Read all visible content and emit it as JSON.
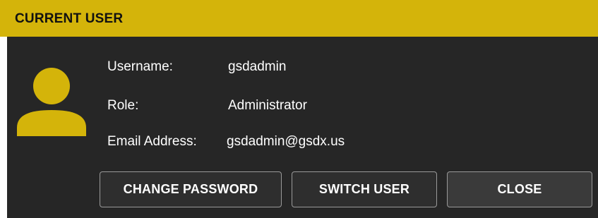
{
  "dialog": {
    "title": "CURRENT USER",
    "accent_color": "#d4b40a",
    "panel_color": "#262626"
  },
  "user": {
    "avatar_icon": "user-icon",
    "fields": [
      {
        "label": "Username:",
        "value": "gsdadmin"
      },
      {
        "label": "Role:",
        "value": "Administrator"
      },
      {
        "label": "Email Address:",
        "value": "gsdadmin@gsdx.us"
      }
    ]
  },
  "buttons": {
    "change_password": "CHANGE PASSWORD",
    "switch_user": "SWITCH USER",
    "close": "CLOSE"
  }
}
